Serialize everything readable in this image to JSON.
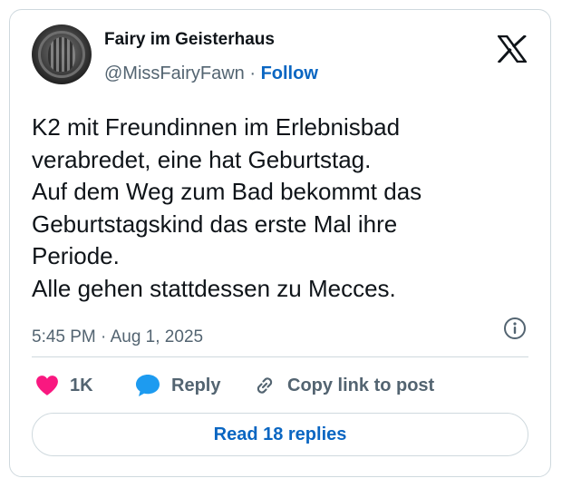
{
  "author": {
    "display_name": "Fairy im Geisterhaus",
    "handle": "@MissFairyFawn",
    "separator": "·",
    "follow_label": "Follow"
  },
  "platform_icon": "x-logo-icon",
  "tweet": {
    "lines": [
      "K2 mit Freundinnen im Erlebnisbad",
      "verabredet, eine hat Geburtstag.",
      "Auf dem Weg zum Bad bekommt das",
      "Geburtstagskind das erste Mal ihre",
      "Periode.",
      "Alle gehen stattdessen zu Mecces."
    ],
    "timestamp": "5:45 PM · Aug 1, 2025"
  },
  "actions": {
    "like_count": "1K",
    "reply_label": "Reply",
    "copy_label": "Copy link to post"
  },
  "read_replies_label": "Read 18 replies",
  "colors": {
    "like": "#f91880",
    "reply": "#1d9bf0",
    "link": "#0a66c2",
    "muted": "#536471"
  }
}
